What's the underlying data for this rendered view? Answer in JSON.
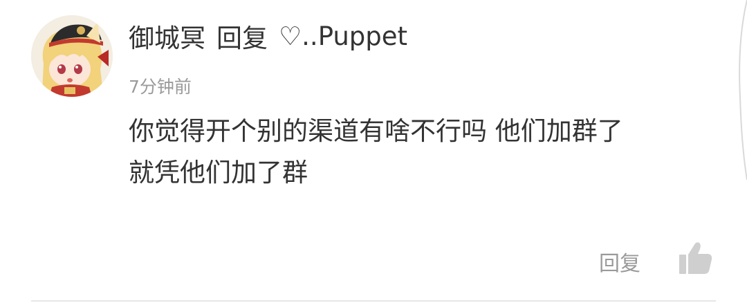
{
  "comment": {
    "author": "御城冥",
    "reply_word": "回复",
    "reply_target": "♡..Puppet",
    "timestamp": "7分钟前",
    "body_lines": [
      "你觉得开个别的渠道有啥不行吗 他们加群了",
      "就凭他们加了群"
    ]
  },
  "actions": {
    "reply_label": "回复",
    "like_icon": "thumbs-up-icon"
  },
  "colors": {
    "text_primary": "#333333",
    "text_secondary": "#9b9b9b",
    "icon_gray": "#cfcfcf",
    "divider": "#e6e6e6"
  }
}
